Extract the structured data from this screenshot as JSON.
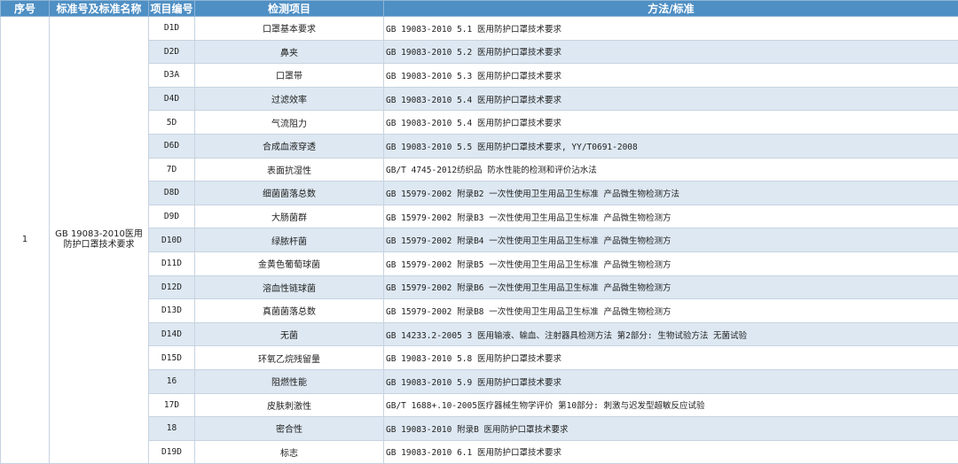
{
  "header": {
    "seq": "序号",
    "standard": "标准号及标准名称",
    "code": "项目编号",
    "item": "检测项目",
    "method": "方法/标准"
  },
  "group": {
    "seq": "1",
    "standard": "GB 19083-2010医用防护口罩技术要求"
  },
  "rows": [
    {
      "code": "D1D",
      "item": "口罩基本要求",
      "method": "GB 19083-2010 5.1 医用防护口罩技术要求"
    },
    {
      "code": "D2D",
      "item": "鼻夹",
      "method": "GB 19083-2010 5.2 医用防护口罩技术要求"
    },
    {
      "code": "D3A",
      "item": "口罩带",
      "method": "GB 19083-2010 5.3 医用防护口罩技术要求"
    },
    {
      "code": "D4D",
      "item": "过滤效率",
      "method": "GB 19083-2010 5.4 医用防护口罩技术要求"
    },
    {
      "code": "5D",
      "item": "气流阻力",
      "method": "GB 19083-2010 5.4 医用防护口罩技术要求"
    },
    {
      "code": "D6D",
      "item": "合成血液穿透",
      "method": "GB 19083-2010 5.5 医用防护口罩技术要求, YY/T0691-2008"
    },
    {
      "code": "7D",
      "item": "表面抗湿性",
      "method": "GB/T 4745-2012纺织品 防水性能的检测和评价沾水法"
    },
    {
      "code": "D8D",
      "item": "细菌菌落总数",
      "method": "GB 15979-2002 附录B2 一次性使用卫生用品卫生标准 产品微生物检测方法"
    },
    {
      "code": "D9D",
      "item": "大肠菌群",
      "method": "GB 15979-2002 附录B3 一次性使用卫生用品卫生标准 产品微生物检测方"
    },
    {
      "code": "D10D",
      "item": "绿脓杆菌",
      "method": "GB 15979-2002 附录B4 一次性使用卫生用品卫生标准 产品微生物检测方"
    },
    {
      "code": "D11D",
      "item": "金黄色葡萄球菌",
      "method": "GB 15979-2002 附录B5 一次性使用卫生用品卫生标准 产品微生物检测方"
    },
    {
      "code": "D12D",
      "item": "溶血性链球菌",
      "method": "GB 15979-2002 附录B6 一次性使用卫生用品卫生标准 产品微生物检测方"
    },
    {
      "code": "D13D",
      "item": "真菌菌落总数",
      "method": "GB 15979-2002 附录B8 一次性使用卫生用品卫生标准 产品微生物检测方"
    },
    {
      "code": "D14D",
      "item": "无菌",
      "method": "GB 14233.2-2005 3 医用输液、输血、注射器具检测方法 第2部分: 生物试验方法 无菌试验"
    },
    {
      "code": "D15D",
      "item": "环氧乙烷残留量",
      "method": "GB 19083-2010 5.8 医用防护口罩技术要求"
    },
    {
      "code": "16",
      "item": "阻燃性能",
      "method": "GB 19083-2010 5.9 医用防护口罩技术要求"
    },
    {
      "code": "17D",
      "item": "皮肤刺激性",
      "method": "GB/T 1688+.10-2005医疗器械生物学评价 第10部分: 刺激与迟发型超敏反应试验"
    },
    {
      "code": "18",
      "item": "密合性",
      "method": "GB 19083-2010 附录B 医用防护口罩技术要求"
    },
    {
      "code": "D19D",
      "item": "标志",
      "method": "GB 19083-2010 6.1 医用防护口罩技术要求"
    }
  ]
}
